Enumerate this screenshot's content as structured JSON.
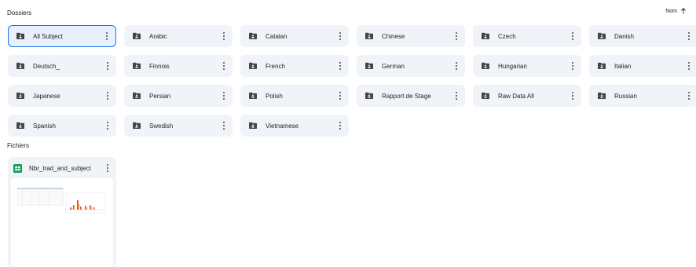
{
  "sections": {
    "folders_label": "Dossiers",
    "files_label": "Fichiers"
  },
  "sort": {
    "label": "Nom",
    "direction_icon": "arrow-up-icon"
  },
  "folders": [
    {
      "name": "All Subject",
      "selected": true
    },
    {
      "name": "Arabic"
    },
    {
      "name": "Catalan"
    },
    {
      "name": "Chinese"
    },
    {
      "name": "Czech"
    },
    {
      "name": "Danish"
    },
    {
      "name": "Deutsch_"
    },
    {
      "name": "Finnois"
    },
    {
      "name": "French"
    },
    {
      "name": "German"
    },
    {
      "name": "Hungarian"
    },
    {
      "name": "Italian"
    },
    {
      "name": "Japanese"
    },
    {
      "name": "Persian"
    },
    {
      "name": "Polish"
    },
    {
      "name": "Rapport de Stage"
    },
    {
      "name": "Raw Data All"
    },
    {
      "name": "Russian"
    },
    {
      "name": "Spanish"
    },
    {
      "name": "Swedish"
    },
    {
      "name": "Vietnamese"
    }
  ],
  "files": [
    {
      "name": "Nbr_trad_and_subject",
      "icon": "google-sheets-icon"
    }
  ],
  "colors": {
    "card_bg": "#f0f4f9",
    "selected_border": "#1a73e8",
    "sheets_green": "#0f9d58",
    "icon_gray": "#444746"
  }
}
